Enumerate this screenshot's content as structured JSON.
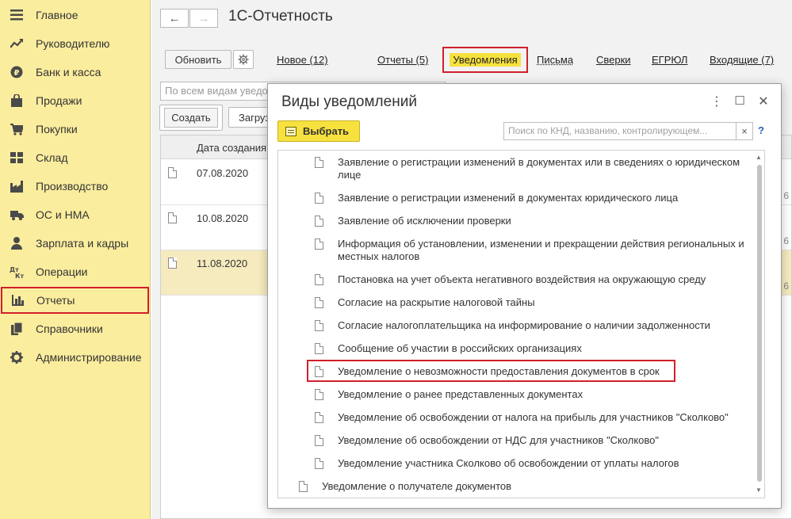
{
  "sidebar": {
    "items": [
      {
        "label": "Главное",
        "icon": "menu-icon"
      },
      {
        "label": "Руководителю",
        "icon": "trend-icon"
      },
      {
        "label": "Банк и касса",
        "icon": "coin-icon"
      },
      {
        "label": "Продажи",
        "icon": "bag-icon"
      },
      {
        "label": "Покупки",
        "icon": "cart-icon"
      },
      {
        "label": "Склад",
        "icon": "warehouse-icon"
      },
      {
        "label": "Производство",
        "icon": "factory-icon"
      },
      {
        "label": "ОС и НМА",
        "icon": "truck-icon"
      },
      {
        "label": "Зарплата и кадры",
        "icon": "person-icon"
      },
      {
        "label": "Операции",
        "icon": "debit-credit-icon"
      },
      {
        "label": "Отчеты",
        "icon": "bar-chart-icon"
      },
      {
        "label": "Справочники",
        "icon": "books-icon"
      },
      {
        "label": "Администрирование",
        "icon": "gear-icon"
      }
    ]
  },
  "main": {
    "title": "1С-Отчетность",
    "back_glyph": "←",
    "forward_glyph": "→",
    "refresh_label": "Обновить",
    "tabs": {
      "new": "Новое (12)",
      "reports": "Отчеты (5)",
      "notices": "Уведомления",
      "letters": "Письма",
      "reconciliations": "Сверки",
      "egrul": "ЕГРЮЛ",
      "incoming": "Входящие (7)"
    },
    "filter_placeholder": "По всем видам уведомлений",
    "create_label": "Создать",
    "load_label": "Загрузить",
    "grid": {
      "date_header": "Дата создания",
      "rows": [
        {
          "date": "07.08.2020",
          "trail": "6"
        },
        {
          "date": "10.08.2020",
          "trail": "6"
        },
        {
          "date": "11.08.2020",
          "trail": "6"
        }
      ]
    }
  },
  "modal": {
    "title": "Виды уведомлений",
    "more_glyph": "⋮",
    "maximize_glyph": "☐",
    "close_glyph": "✕",
    "select_label": "Выбрать",
    "search_placeholder": "Поиск по КНД, названию, контролирующем...",
    "search_clear": "×",
    "help": "?",
    "items": [
      "Заявление о регистрации изменений в документах или в сведениях о юридическом лице",
      "Заявление о регистрации изменений в документах юридического лица",
      "Заявление об исключении проверки",
      "Информация об установлении, изменении и прекращении действия региональных и местных налогов",
      "Постановка на учет объекта негативного воздействия на окружающую среду",
      "Согласие на раскрытие налоговой тайны",
      "Согласие налогоплательщика на информирование о наличии задолженности",
      "Сообщение об участии в российских организациях",
      "Уведомление о невозможности предоставления документов в срок",
      "Уведомление о ранее представленных документах",
      "Уведомление об освобождении от налога на прибыль для участников \"Сколково\"",
      "Уведомление об освобождении от НДС для участников \"Сколково\"",
      "Уведомление участника Сколково об освобождении от уплаты налогов"
    ],
    "top_item": "Уведомление о получателе документов"
  }
}
